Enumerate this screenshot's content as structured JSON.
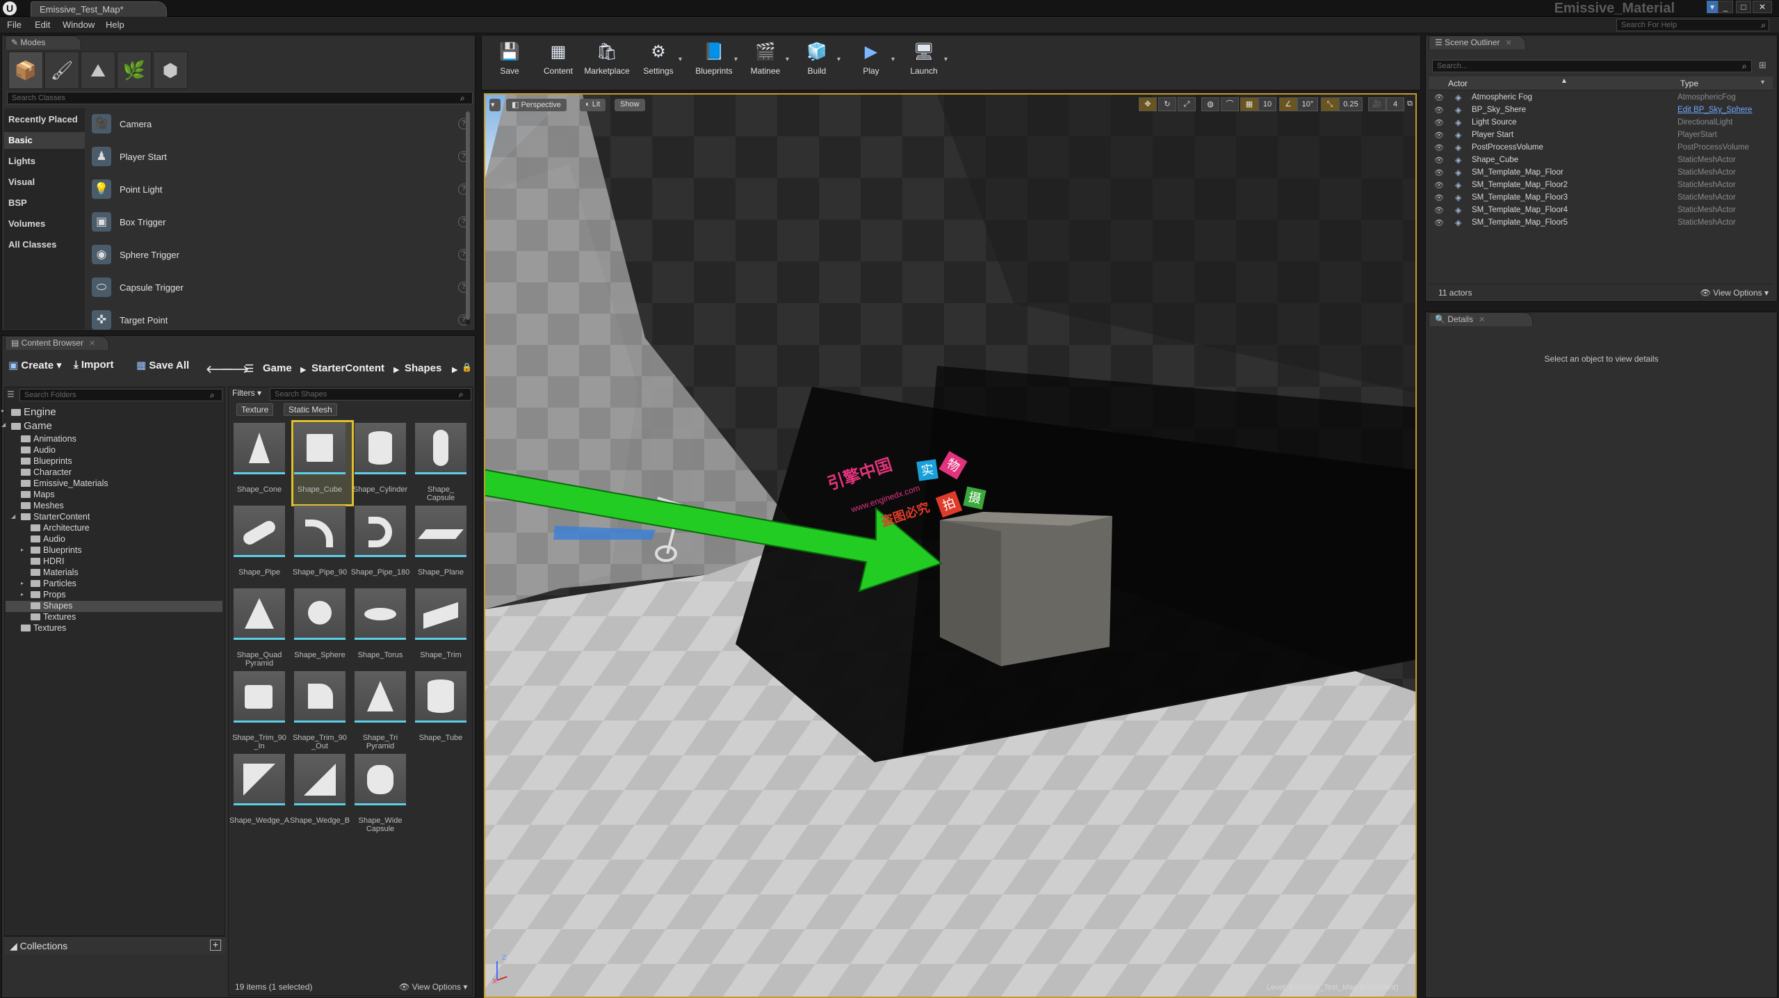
{
  "window": {
    "doc_tab": "Emissive_Test_Map*",
    "app_title": "Emissive_Material",
    "help_search_placeholder": "Search For Help",
    "controls": {
      "minimize": "_",
      "maximize": "□",
      "close": "✕"
    }
  },
  "menu": [
    "File",
    "Edit",
    "Window",
    "Help"
  ],
  "modes": {
    "tab_label": "Modes",
    "mode_icons": [
      "place-mode-icon",
      "paint-mode-icon",
      "landscape-mode-icon",
      "foliage-mode-icon",
      "geometry-mode-icon"
    ],
    "search_placeholder": "Search Classes",
    "categories": [
      "Recently Placed",
      "Basic",
      "Lights",
      "Visual",
      "BSP",
      "Volumes",
      "All Classes"
    ],
    "selected_category": "Basic",
    "items": [
      {
        "label": "Camera",
        "icon": "camera-icon"
      },
      {
        "label": "Player Start",
        "icon": "player-start-icon"
      },
      {
        "label": "Point Light",
        "icon": "point-light-icon"
      },
      {
        "label": "Box Trigger",
        "icon": "box-trigger-icon"
      },
      {
        "label": "Sphere Trigger",
        "icon": "sphere-trigger-icon"
      },
      {
        "label": "Capsule Trigger",
        "icon": "capsule-trigger-icon"
      },
      {
        "label": "Target Point",
        "icon": "target-point-icon"
      }
    ],
    "help_glyph": "?"
  },
  "content_browser": {
    "tab_label": "Content Browser",
    "buttons": {
      "create": "Create",
      "import": "Import",
      "save_all": "Save All"
    },
    "breadcrumb": [
      "Game",
      "StarterContent",
      "Shapes"
    ],
    "folder_search_placeholder": "Search Folders",
    "filters_label": "Filters",
    "asset_search_placeholder": "Search Shapes",
    "filter_chips": [
      "Texture",
      "Static Mesh"
    ],
    "tree": [
      {
        "label": "Engine",
        "depth": 0,
        "expander": "▸"
      },
      {
        "label": "Game",
        "depth": 0,
        "expander": "◢"
      },
      {
        "label": "Animations",
        "depth": 1
      },
      {
        "label": "Audio",
        "depth": 1
      },
      {
        "label": "Blueprints",
        "depth": 1
      },
      {
        "label": "Character",
        "depth": 1
      },
      {
        "label": "Emissive_Materials",
        "depth": 1
      },
      {
        "label": "Maps",
        "depth": 1
      },
      {
        "label": "Meshes",
        "depth": 1
      },
      {
        "label": "StarterContent",
        "depth": 1,
        "expander": "◢"
      },
      {
        "label": "Architecture",
        "depth": 2
      },
      {
        "label": "Audio",
        "depth": 2
      },
      {
        "label": "Blueprints",
        "depth": 2,
        "expander": "▸"
      },
      {
        "label": "HDRI",
        "depth": 2
      },
      {
        "label": "Materials",
        "depth": 2
      },
      {
        "label": "Particles",
        "depth": 2,
        "expander": "▸"
      },
      {
        "label": "Props",
        "depth": 2,
        "expander": "▸"
      },
      {
        "label": "Shapes",
        "depth": 2,
        "selected": true
      },
      {
        "label": "Textures",
        "depth": 2
      },
      {
        "label": "Textures",
        "depth": 1
      }
    ],
    "assets": [
      {
        "name": "Shape_Cone",
        "shape": "cone"
      },
      {
        "name": "Shape_Cube",
        "shape": "cube",
        "selected": true
      },
      {
        "name": "Shape_Cylinder",
        "shape": "cylinder"
      },
      {
        "name": "Shape_\nCapsule",
        "shape": "capsule"
      },
      {
        "name": "Shape_Pipe",
        "shape": "pipe"
      },
      {
        "name": "Shape_Pipe_90",
        "shape": "pipe90"
      },
      {
        "name": "Shape_Pipe_180",
        "shape": "pipe180"
      },
      {
        "name": "Shape_Plane",
        "shape": "plane"
      },
      {
        "name": "Shape_Quad\nPyramid",
        "shape": "pyramid"
      },
      {
        "name": "Shape_Sphere",
        "shape": "sphere"
      },
      {
        "name": "Shape_Torus",
        "shape": "torus"
      },
      {
        "name": "Shape_Trim",
        "shape": "trim"
      },
      {
        "name": "Shape_Trim_90\n_In",
        "shape": "trim90in"
      },
      {
        "name": "Shape_Trim_90\n_Out",
        "shape": "trim90out"
      },
      {
        "name": "Shape_Tri\nPyramid",
        "shape": "tripyramid"
      },
      {
        "name": "Shape_Tube",
        "shape": "tube"
      },
      {
        "name": "Shape_Wedge_A",
        "shape": "wedgea"
      },
      {
        "name": "Shape_Wedge_B",
        "shape": "wedgeb"
      },
      {
        "name": "Shape_Wide\nCapsule",
        "shape": "widecapsule"
      }
    ],
    "collections_label": "Collections",
    "status": "19 items (1 selected)",
    "view_options": "View Options"
  },
  "toolbar": [
    {
      "label": "Save",
      "icon": "save-icon",
      "dropdown": false
    },
    {
      "label": "Content",
      "icon": "content-icon",
      "dropdown": false
    },
    {
      "label": "Marketplace",
      "icon": "marketplace-icon",
      "dropdown": false
    },
    {
      "label": "Settings",
      "icon": "settings-icon",
      "dropdown": true
    },
    {
      "label": "Blueprints",
      "icon": "blueprints-icon",
      "dropdown": true
    },
    {
      "label": "Matinee",
      "icon": "matinee-icon",
      "dropdown": true
    },
    {
      "label": "Build",
      "icon": "build-icon",
      "dropdown": true
    },
    {
      "label": "Play",
      "icon": "play-icon",
      "dropdown": true
    },
    {
      "label": "Launch",
      "icon": "launch-icon",
      "dropdown": true
    }
  ],
  "viewport": {
    "perspective": "Perspective",
    "lit": "Lit",
    "show": "Show",
    "grid_snap": "10",
    "rotation_snap": "10°",
    "scale_snap": "0.25",
    "camera_speed": "4",
    "level_prefix": "Level:",
    "level_name": "Emissive_Test_Map (Persistent)",
    "axis_labels": {
      "z": "Z",
      "x": "X"
    },
    "watermark": {
      "cn_title": "引擎中国",
      "url": "www.enginedx.com",
      "slogan": "盗图必究",
      "tiles": [
        {
          "char": "实",
          "color": "#1aa0d8"
        },
        {
          "char": "物",
          "color": "#e2337c"
        },
        {
          "char": "拍",
          "color": "#e03a2a"
        },
        {
          "char": "摄",
          "color": "#3aa83a"
        }
      ]
    }
  },
  "outliner": {
    "tab_label": "Scene Outliner",
    "search_placeholder": "Search...",
    "col_actor": "Actor",
    "col_type": "Type",
    "rows": [
      {
        "name": "Atmospheric Fog",
        "type": "AtmosphericFog",
        "link": false
      },
      {
        "name": "BP_Sky_Shere",
        "type": "Edit BP_Sky_Sphere",
        "link": true
      },
      {
        "name": "Light Source",
        "type": "DirectionalLight",
        "link": false
      },
      {
        "name": "Player Start",
        "type": "PlayerStart",
        "link": false
      },
      {
        "name": "PostProcessVolume",
        "type": "PostProcessVolume",
        "link": false
      },
      {
        "name": "Shape_Cube",
        "type": "StaticMeshActor",
        "link": false
      },
      {
        "name": "SM_Template_Map_Floor",
        "type": "StaticMeshActor",
        "link": false
      },
      {
        "name": "SM_Template_Map_Floor2",
        "type": "StaticMeshActor",
        "link": false
      },
      {
        "name": "SM_Template_Map_Floor3",
        "type": "StaticMeshActor",
        "link": false
      },
      {
        "name": "SM_Template_Map_Floor4",
        "type": "StaticMeshActor",
        "link": false
      },
      {
        "name": "SM_Template_Map_Floor5",
        "type": "StaticMeshActor",
        "link": false
      }
    ],
    "count": "11 actors",
    "view_options": "View Options"
  },
  "details": {
    "tab_label": "Details",
    "empty_text": "Select an object to view details"
  },
  "colors": {
    "selection_yellow": "#e0c030",
    "viewport_border": "#c49a2a",
    "asset_underline": "#5cd0e8",
    "arrow_green": "#22cc22"
  }
}
